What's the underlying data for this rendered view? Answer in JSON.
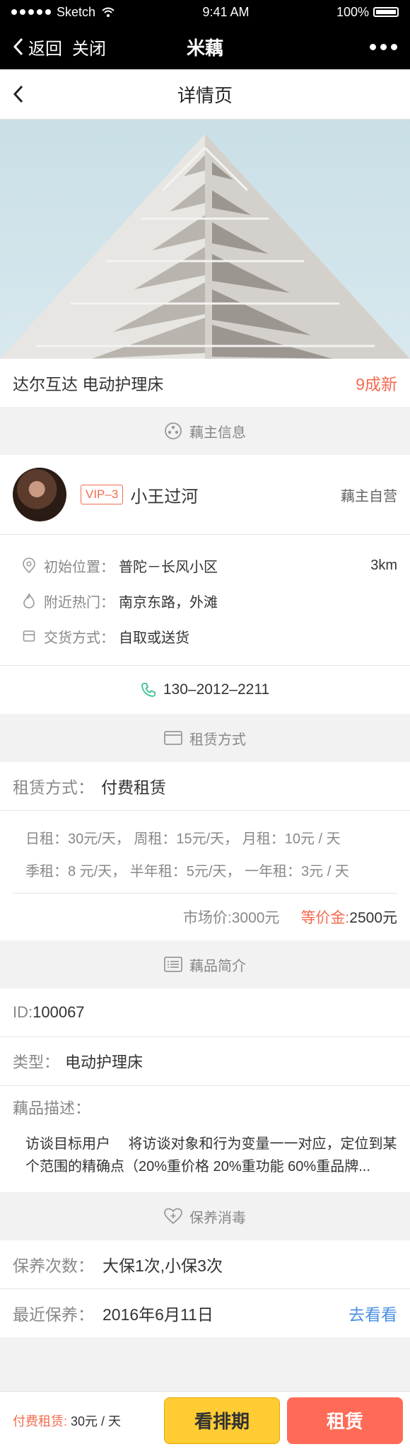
{
  "status_bar": {
    "carrier": "Sketch",
    "time": "9:41 AM",
    "battery": "100%"
  },
  "nav": {
    "back_label": "返回",
    "close_label": "关闭",
    "title": "米藕"
  },
  "sub_header": {
    "title": "详情页"
  },
  "product": {
    "title": "达尔互达 电动护理床",
    "condition": "9成新"
  },
  "owner_section": {
    "header": "藕主信息"
  },
  "owner": {
    "vip": "VIP–3",
    "name": "小王过河",
    "tag": "藕主自营"
  },
  "info": [
    {
      "icon": "location-pin-icon",
      "label": "初始位置：",
      "value": "普陀－长风小区",
      "right": "3km"
    },
    {
      "icon": "flame-icon",
      "label": "附近热门：",
      "value": "南京东路，外滩",
      "right": ""
    },
    {
      "icon": "package-icon",
      "label": "交货方式：",
      "value": "自取或送货",
      "right": ""
    }
  ],
  "phone": "130–2012–2211",
  "lease_section": {
    "header": "租赁方式"
  },
  "lease": {
    "label": "租赁方式：",
    "value": "付费租赁"
  },
  "prices": {
    "line1": "日租：30元/天，  周租：15元/天，  月租：10元 / 天",
    "line2": "季租：8 元/天，  半年租：5元/天，  一年租：3元 / 天"
  },
  "deposit": {
    "market": "市场价:3000元",
    "deposit_label": "等价金:",
    "deposit_value": "2500元"
  },
  "intro_section": {
    "header": "藕品简介"
  },
  "intro": {
    "id_label": "ID:",
    "id_value": "100067",
    "type_label": "类型：",
    "type_value": "电动护理床",
    "desc_label": "藕品描述：",
    "desc_text": "访谈目标用户　  将访谈对象和行为变量一一对应，定位到某个范围的精确点（20%重价格  20%重功能  60%重品牌..."
  },
  "maintenance_section": {
    "header": "保养消毒"
  },
  "maintenance": {
    "count_label": "保养次数：",
    "count_value": "大保1次,小保3次",
    "last_label": "最近保养：",
    "last_value": "2016年6月11日",
    "link": "去看看"
  },
  "bottom": {
    "price_label": "付费租赁:",
    "price_value": " 30元 / 天",
    "schedule_button": "看排期",
    "rent_button": "租赁"
  },
  "colors": {
    "accent": "#f26b50",
    "link": "#4a90e2",
    "yellow": "#ffcc33",
    "red": "#ff6b57",
    "phone_icon": "#3dbf8f"
  }
}
